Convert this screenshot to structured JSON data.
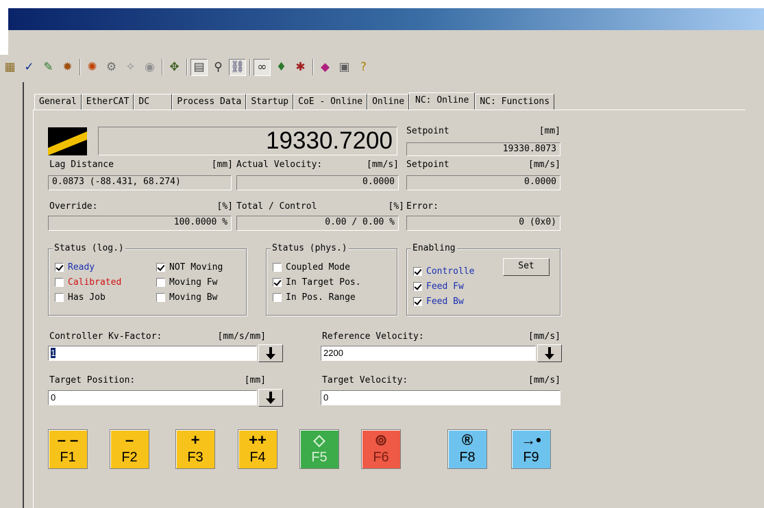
{
  "tabs": [
    "General",
    "EtherCAT",
    "DC",
    "Process Data",
    "Startup",
    "CoE - Online",
    "Online",
    "NC: Online",
    "NC: Functions"
  ],
  "active_tab": "NC: Online",
  "toolbar_icons": [
    "cascade-windows-icon",
    "check-icon",
    "build-icon",
    "activate-icon",
    "network-icon",
    "scan-icon",
    "magic-wand-icon",
    "gear-icon",
    "arrow-icon",
    "document-icon",
    "search-icon",
    "mapping-icon",
    "glasses-icon",
    "person-icon",
    "debug-icon",
    "book-icon",
    "info-icon",
    "help-icon"
  ],
  "actual_position": "19330.7200",
  "setpoint_pos": {
    "label": "Setpoint",
    "unit": "[mm]",
    "value": "19330.8073"
  },
  "lag": {
    "label": "Lag Distance",
    "unit": "[mm]",
    "value": "0.0873  (-88.431, 68.274)"
  },
  "actual_velocity": {
    "label": "Actual Velocity:",
    "unit": "[mm/s]",
    "value": "0.0000"
  },
  "setpoint_vel": {
    "label": "Setpoint",
    "unit": "[mm/s]",
    "value": "0.0000"
  },
  "override": {
    "label": "Override:",
    "unit": "[%]",
    "value": "100.0000 %"
  },
  "total_control": {
    "label": "Total / Control",
    "unit": "[%]",
    "value": "0.00 /  0.00 %"
  },
  "error": {
    "label": "Error:",
    "value": "0  (0x0)"
  },
  "status_log": {
    "title": "Status (log.)",
    "items": [
      {
        "label": "Ready",
        "checked": true,
        "color": "#1a2fb0"
      },
      {
        "label": "NOT Moving",
        "checked": true,
        "color": "#000000"
      },
      {
        "label": "Calibrated",
        "checked": false,
        "color": "#d01010"
      },
      {
        "label": "Moving Fw",
        "checked": false,
        "color": "#000000"
      },
      {
        "label": "Has Job",
        "checked": false,
        "color": "#000000"
      },
      {
        "label": "Moving Bw",
        "checked": false,
        "color": "#000000"
      }
    ]
  },
  "status_phys": {
    "title": "Status (phys.)",
    "items": [
      {
        "label": "Coupled Mode",
        "checked": false
      },
      {
        "label": "In Target Pos.",
        "checked": true
      },
      {
        "label": "In Pos. Range",
        "checked": false
      }
    ]
  },
  "enabling": {
    "title": "Enabling",
    "items": [
      {
        "label": "Controlle",
        "checked": true
      },
      {
        "label": "Feed Fw",
        "checked": true
      },
      {
        "label": "Feed Bw",
        "checked": true
      }
    ],
    "set_label": "Set",
    "color": "#1a2fb0"
  },
  "kv": {
    "label": "Controller Kv-Factor:",
    "unit": "[mm/s/mm]",
    "value": "1"
  },
  "ref_vel": {
    "label": "Reference Velocity:",
    "unit": "[mm/s]",
    "value": "2200"
  },
  "target_pos": {
    "label": "Target Position:",
    "unit": "[mm]",
    "value": "0"
  },
  "target_vel": {
    "label": "Target Velocity:",
    "unit": "[mm/s]",
    "value": "0"
  },
  "fkeys": [
    {
      "symbol": "– –",
      "key": "F1",
      "color": "#f7c21a",
      "text_color": "#000000"
    },
    {
      "symbol": "–",
      "key": "F2",
      "color": "#f7c21a",
      "text_color": "#000000"
    },
    {
      "symbol": "+",
      "key": "F3",
      "color": "#f7c21a",
      "text_color": "#000000"
    },
    {
      "symbol": "++",
      "key": "F4",
      "color": "#f7c21a",
      "text_color": "#000000"
    },
    {
      "symbol": "◇",
      "key": "F5",
      "color": "#3cab4a",
      "text_color": "#d8f0d8"
    },
    {
      "symbol": "⊚",
      "key": "F6",
      "color": "#ee5a45",
      "text_color": "#7a1e14"
    },
    {
      "symbol": "®",
      "key": "F8",
      "color": "#6ec3ee",
      "text_color": "#000000"
    },
    {
      "symbol": "→•",
      "key": "F9",
      "color": "#6ec3ee",
      "text_color": "#000000"
    }
  ]
}
